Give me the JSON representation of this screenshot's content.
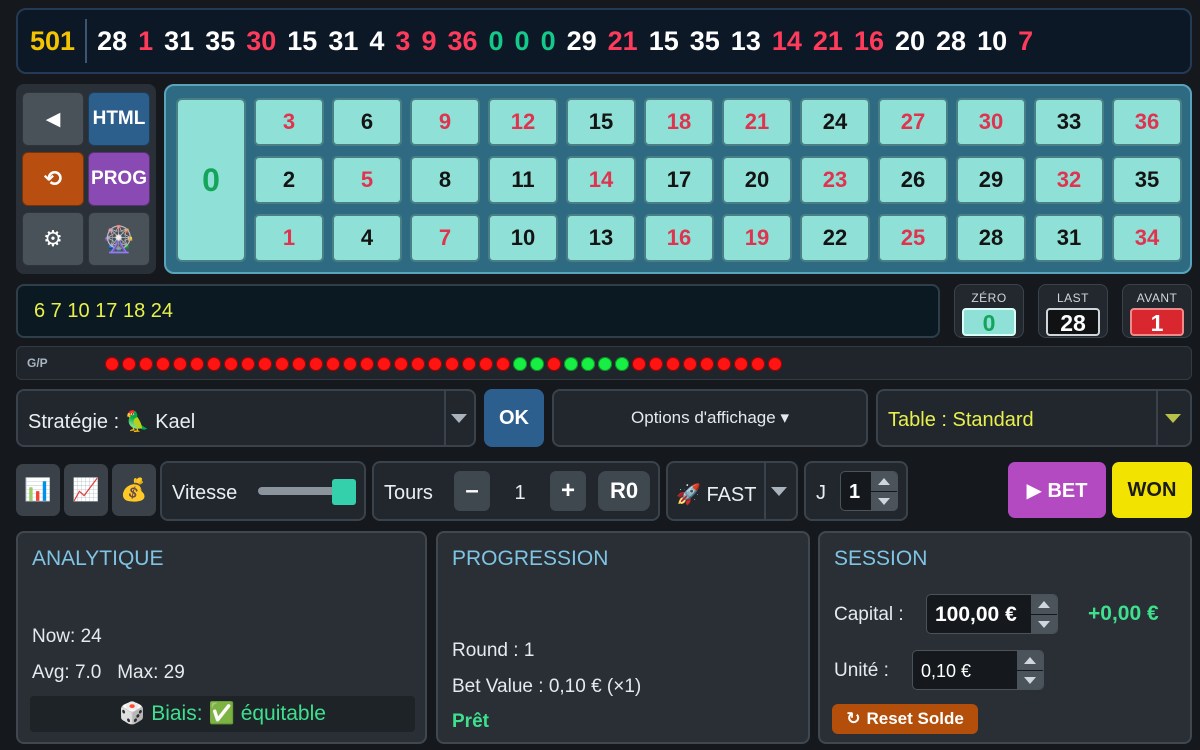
{
  "history": {
    "count": "501",
    "numbers": [
      {
        "v": "28",
        "c": "black"
      },
      {
        "v": "1",
        "c": "red"
      },
      {
        "v": "31",
        "c": "black"
      },
      {
        "v": "35",
        "c": "black"
      },
      {
        "v": "30",
        "c": "red"
      },
      {
        "v": "15",
        "c": "black"
      },
      {
        "v": "31",
        "c": "black"
      },
      {
        "v": "4",
        "c": "black"
      },
      {
        "v": "3",
        "c": "red"
      },
      {
        "v": "9",
        "c": "red"
      },
      {
        "v": "36",
        "c": "red"
      },
      {
        "v": "0",
        "c": "green"
      },
      {
        "v": "0",
        "c": "green"
      },
      {
        "v": "0",
        "c": "green"
      },
      {
        "v": "29",
        "c": "black"
      },
      {
        "v": "21",
        "c": "red"
      },
      {
        "v": "15",
        "c": "black"
      },
      {
        "v": "35",
        "c": "black"
      },
      {
        "v": "13",
        "c": "black"
      },
      {
        "v": "14",
        "c": "red"
      },
      {
        "v": "21",
        "c": "red"
      },
      {
        "v": "16",
        "c": "red"
      },
      {
        "v": "20",
        "c": "black"
      },
      {
        "v": "28",
        "c": "black"
      },
      {
        "v": "10",
        "c": "black"
      },
      {
        "v": "7",
        "c": "red"
      }
    ]
  },
  "controls": {
    "back_icon": "◀",
    "html_label": "HTML",
    "refresh_icon": "⟲",
    "prog_label": "PROG",
    "gear_icon": "⚙",
    "wheel_icon": "🎡"
  },
  "grid": {
    "zero": "0",
    "rows": [
      [
        {
          "v": "3",
          "c": "red"
        },
        {
          "v": "6",
          "c": "black"
        },
        {
          "v": "9",
          "c": "red"
        },
        {
          "v": "12",
          "c": "red"
        },
        {
          "v": "15",
          "c": "black"
        },
        {
          "v": "18",
          "c": "red"
        },
        {
          "v": "21",
          "c": "red"
        },
        {
          "v": "24",
          "c": "black"
        },
        {
          "v": "27",
          "c": "red"
        },
        {
          "v": "30",
          "c": "red"
        },
        {
          "v": "33",
          "c": "black"
        },
        {
          "v": "36",
          "c": "red"
        }
      ],
      [
        {
          "v": "2",
          "c": "black"
        },
        {
          "v": "5",
          "c": "red"
        },
        {
          "v": "8",
          "c": "black"
        },
        {
          "v": "11",
          "c": "black"
        },
        {
          "v": "14",
          "c": "red"
        },
        {
          "v": "17",
          "c": "black"
        },
        {
          "v": "20",
          "c": "black"
        },
        {
          "v": "23",
          "c": "red"
        },
        {
          "v": "26",
          "c": "black"
        },
        {
          "v": "29",
          "c": "black"
        },
        {
          "v": "32",
          "c": "red"
        },
        {
          "v": "35",
          "c": "black"
        }
      ],
      [
        {
          "v": "1",
          "c": "red"
        },
        {
          "v": "4",
          "c": "black"
        },
        {
          "v": "7",
          "c": "red"
        },
        {
          "v": "10",
          "c": "black"
        },
        {
          "v": "13",
          "c": "black"
        },
        {
          "v": "16",
          "c": "red"
        },
        {
          "v": "19",
          "c": "red"
        },
        {
          "v": "22",
          "c": "black"
        },
        {
          "v": "25",
          "c": "red"
        },
        {
          "v": "28",
          "c": "black"
        },
        {
          "v": "31",
          "c": "black"
        },
        {
          "v": "34",
          "c": "red"
        }
      ]
    ]
  },
  "numbers_field": "6 7 10 17 18 24",
  "indicators": {
    "zero": {
      "label": "ZÉRO",
      "value": "0"
    },
    "last": {
      "label": "LAST",
      "value": "28"
    },
    "avant": {
      "label": "AVANT",
      "value": "1"
    }
  },
  "gp": {
    "label": "G/P",
    "results": [
      "L",
      "L",
      "L",
      "L",
      "L",
      "L",
      "L",
      "L",
      "L",
      "L",
      "L",
      "L",
      "L",
      "L",
      "L",
      "L",
      "L",
      "L",
      "L",
      "L",
      "L",
      "L",
      "L",
      "L",
      "W",
      "W",
      "L",
      "W",
      "W",
      "W",
      "W",
      "L",
      "L",
      "L",
      "L",
      "L",
      "L",
      "L",
      "L",
      "L"
    ]
  },
  "strategy": {
    "label": "Stratégie :",
    "icon": "🦜",
    "value": "Kael"
  },
  "ok_label": "OK",
  "options_label": "Options d'affichage ▾",
  "table_label": "Table : Standard",
  "toolbar": {
    "chart_icon": "📊",
    "trend_icon": "📈",
    "money_icon": "💰",
    "speed_label": "Vitesse",
    "speed_level": 0.88,
    "tours_label": "Tours",
    "minus": "–",
    "plus": "+",
    "tours_value": "1",
    "r0_label": "R0",
    "fast_icon": "🚀",
    "fast_label": "FAST",
    "j_label": "J",
    "j_value": "1",
    "bet_label": "▶ BET",
    "won_label": "WON"
  },
  "analytics": {
    "title": "ANALYTIQUE",
    "now": "Now: 24",
    "avg_max": "Avg: 7.0   Max: 29",
    "biais_icon": "🎲",
    "biais_label": "Biais:",
    "biais_check": "✅",
    "biais_value": "équitable"
  },
  "progression": {
    "title": "PROGRESSION",
    "round": "Round : 1",
    "bet_value": "Bet Value : 0,10 € (×1)",
    "status": "Prêt"
  },
  "session": {
    "title": "SESSION",
    "capital_label": "Capital :",
    "capital_value": "100,00 €",
    "gain": "+0,00 €",
    "unit_label": "Unité :",
    "unit_value": "0,10 €",
    "reset_icon": "↻",
    "reset_label": "Reset Solde"
  }
}
